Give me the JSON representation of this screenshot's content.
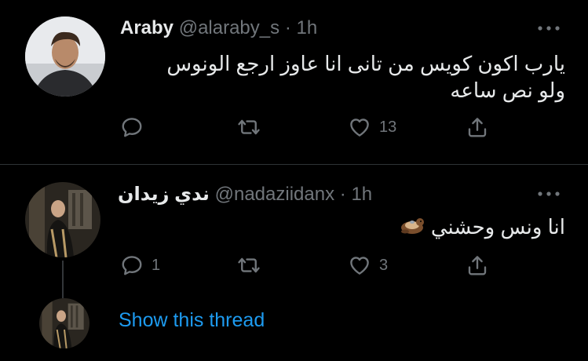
{
  "colors": {
    "background": "#000000",
    "text_primary": "#e7e9ea",
    "text_secondary": "#71767b",
    "link": "#1d9bf0",
    "divider": "#2f3336"
  },
  "tweets": [
    {
      "author_name": "Araby",
      "handle": "@alaraby_s",
      "separator": "·",
      "time": "1h",
      "text_lines": [
        "يارب اكون كويس من تانى انا عاوز ارجع الونوس",
        "ولو نص ساعه"
      ],
      "actions": {
        "reply": {
          "icon": "reply-icon",
          "count": ""
        },
        "retweet": {
          "icon": "retweet-icon",
          "count": ""
        },
        "like": {
          "icon": "heart-icon",
          "count": "13"
        },
        "share": {
          "icon": "share-icon",
          "count": ""
        }
      }
    },
    {
      "author_name": "ندي زيدان",
      "handle": "@nadaziidanx",
      "separator": "·",
      "time": "1h",
      "text": "انا ونس وحشني",
      "emoji": "otter-emoji",
      "actions": {
        "reply": {
          "icon": "reply-icon",
          "count": "1"
        },
        "retweet": {
          "icon": "retweet-icon",
          "count": ""
        },
        "like": {
          "icon": "heart-icon",
          "count": "3"
        },
        "share": {
          "icon": "share-icon",
          "count": ""
        }
      }
    }
  ],
  "thread": {
    "show_thread_label": "Show this thread"
  }
}
